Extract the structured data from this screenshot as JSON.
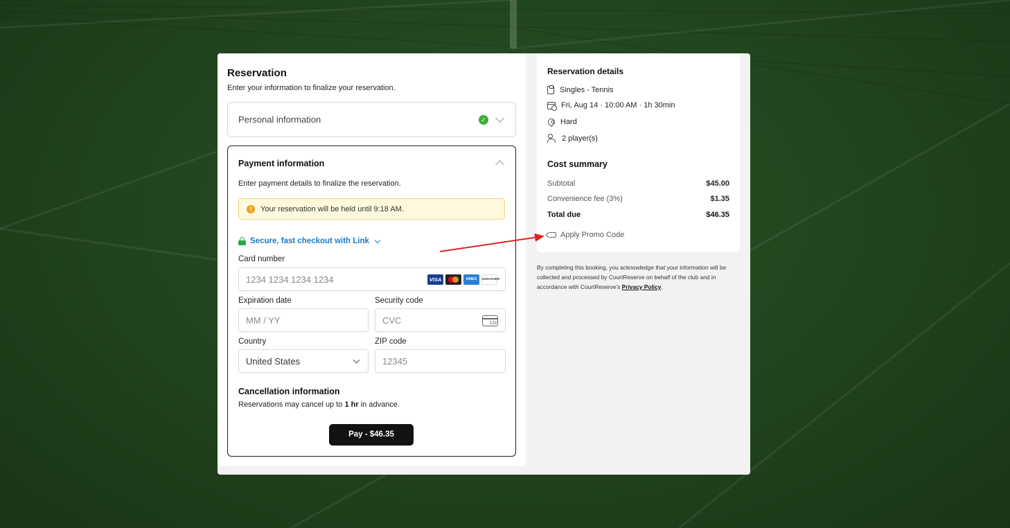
{
  "reservation": {
    "title": "Reservation",
    "subtitle": "Enter your information to finalize your reservation."
  },
  "personal": {
    "label": "Personal information",
    "status": "completed"
  },
  "payment": {
    "title": "Payment information",
    "description": "Enter payment details to finalize the reservation.",
    "hold_notice": "Your reservation will be held until 9:18 AM.",
    "link_checkout": "Secure, fast checkout with Link",
    "card_number_label": "Card number",
    "card_number_placeholder": "1234 1234 1234 1234",
    "card_brands": [
      "VISA",
      "mastercard",
      "AMEX",
      "DISCOVER"
    ],
    "expiration_label": "Expiration date",
    "expiration_placeholder": "MM / YY",
    "security_label": "Security code",
    "security_placeholder": "CVC",
    "cvc_icon_text": "123",
    "country_label": "Country",
    "country_value": "United States",
    "zip_label": "ZIP code",
    "zip_placeholder": "12345"
  },
  "cancellation": {
    "title": "Cancellation information",
    "text_prefix": "Reservations may cancel up to ",
    "text_bold": "1 hr",
    "text_suffix": " in advance."
  },
  "pay_button": "Pay - $46.35",
  "details": {
    "title": "Reservation details",
    "items": [
      {
        "icon": "clipboard-icon",
        "text": "Singles - Tennis"
      },
      {
        "icon": "calendar-clock-icon",
        "text": "Fri, Aug 14 · 10:00 AM · 1h 30min"
      },
      {
        "icon": "map-pin-icon",
        "text": "Hard"
      },
      {
        "icon": "users-icon",
        "text": "2 player(s)"
      }
    ]
  },
  "cost": {
    "title": "Cost summary",
    "subtotal_label": "Subtotal",
    "subtotal_value": "$45.00",
    "fee_label": "Convenience fee (3%)",
    "fee_value": "$1.35",
    "total_label": "Total due",
    "total_value": "$46.35",
    "promo_label": "Apply Promo Code"
  },
  "disclaimer": {
    "text": "By completing this booking, you acknowledge that your information will be collected and processed by CourtReserve on behalf of the club and in accordance with CourtReserve's ",
    "link": "Privacy Policy",
    "end": "."
  },
  "colors": {
    "background": "#22461f",
    "link_blue": "#1a7cc9",
    "success_green": "#3fae3a",
    "warning_bg": "#fff8dc",
    "annotation_arrow": "#e02020",
    "button_dark": "#121212"
  }
}
